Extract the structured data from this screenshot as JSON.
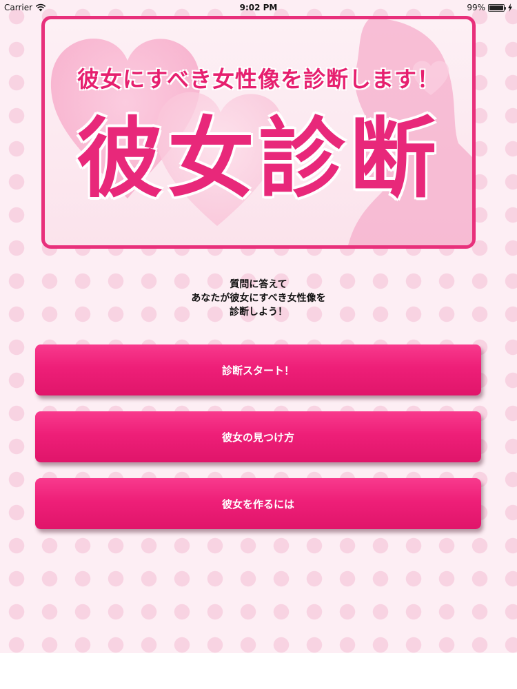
{
  "status_bar": {
    "carrier": "Carrier",
    "time": "9:02 PM",
    "battery": "99%"
  },
  "banner": {
    "subtitle": "彼女にすべき女性像を診断します！",
    "title": "彼女診断"
  },
  "intro": {
    "line1": "質問に答えて",
    "line2": "あなたが彼女にすべき女性像を",
    "line3": "診断しよう！"
  },
  "buttons": {
    "start": "診断スタート！",
    "find": "彼女の見つけ方",
    "make": "彼女を作るには"
  },
  "colors": {
    "accent": "#e8307b",
    "button": "#ee1f78",
    "background": "#fdeef4",
    "dot": "#f8d3e2"
  },
  "icons": [
    "wifi-icon",
    "battery-icon",
    "charging-bolt-icon"
  ]
}
